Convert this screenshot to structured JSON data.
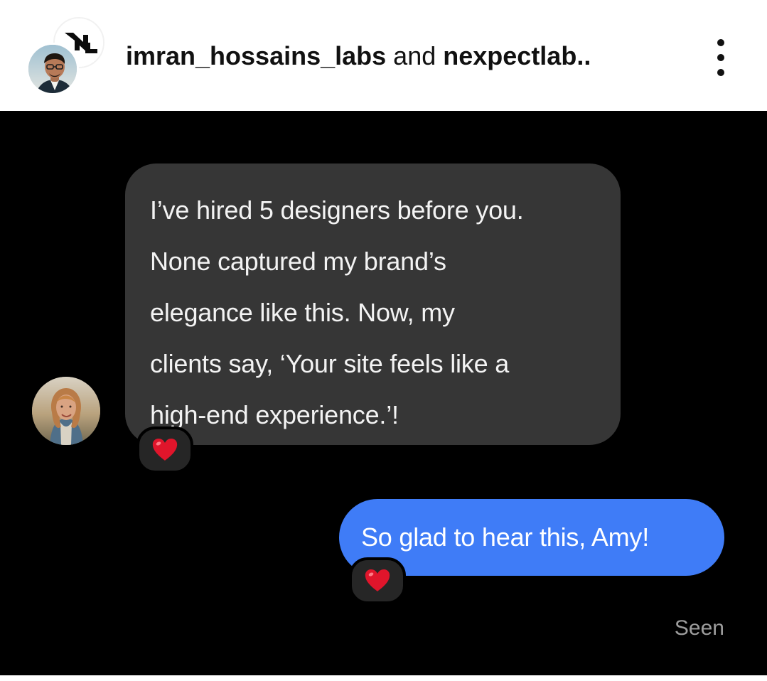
{
  "header": {
    "username_1": "imran_hossains_labs",
    "connector": " and ",
    "username_2": "nexpectlab.."
  },
  "conversation": {
    "received_lines": [
      "I’ve hired 5 designers before you.",
      "None captured my brand’s",
      "elegance like this. Now, my",
      "clients say, ‘Your site feels like a",
      "high-end experience.’!"
    ],
    "sent_text": "So glad to hear this, Amy!",
    "status": "Seen"
  },
  "icons": {
    "logo": "nl-logo-icon",
    "more": "more-vertical-icon",
    "reaction": "heart-icon"
  },
  "colors": {
    "chat_background": "#000000",
    "received_bubble": "#363636",
    "sent_bubble": "#3f7cf7",
    "heart": "#e0152b"
  }
}
